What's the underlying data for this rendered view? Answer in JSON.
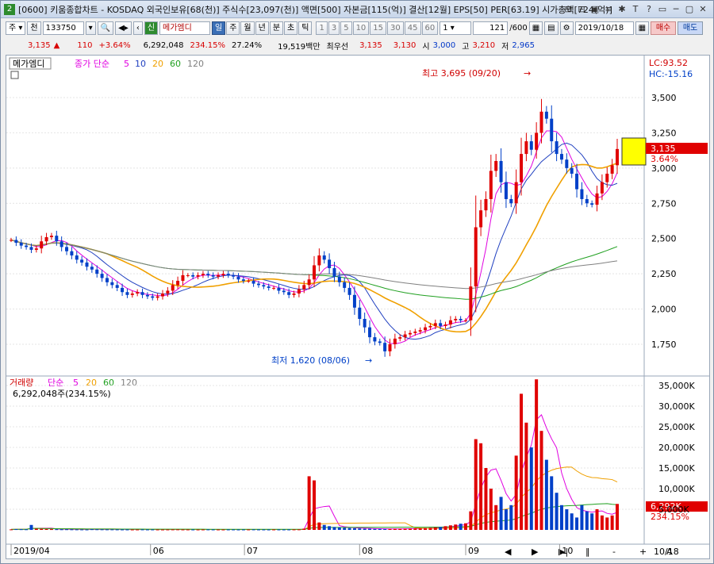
{
  "window": {
    "number": "2",
    "title": "[0600] 키움종합차트 - KOSDAQ 외국인보유[68(천)] 주식수[23,097(천)] 액면[500] 자본금[115(억)] 결산[12월] EPS[50] PER[63.19] 시가총액[724(억)]",
    "icons": [
      "⊞",
      "⊟",
      "▣",
      "≡",
      "✱",
      "T",
      "?",
      "▭",
      "─",
      "▢",
      "✕"
    ]
  },
  "toolbar": {
    "market": "주",
    "chart_type": "천",
    "code": "133750",
    "credit": "신",
    "stock_name": "메가엠디",
    "periods": [
      "일",
      "주",
      "월",
      "년",
      "분",
      "초",
      "틱"
    ],
    "active_period": "일",
    "intervals": [
      "1",
      "3",
      "5",
      "10",
      "15",
      "30",
      "45",
      "60"
    ],
    "count_select": "1",
    "view": "121",
    "total": "/600",
    "date": "2019/10/18",
    "buy": "매수",
    "sell": "매도"
  },
  "quote": {
    "price": "3,135",
    "arrow": "▲",
    "change": "110",
    "change_pct": "+3.64%",
    "volume": "6,292,048",
    "volume_ratio": "234.15%",
    "turnover": "27.24%",
    "amount": "19,519백만",
    "best": "최우선",
    "ask": "3,135",
    "bid": "3,130",
    "open_label": "시",
    "open": "3,000",
    "high_label": "고",
    "high": "3,210",
    "low_label": "저",
    "low": "2,965"
  },
  "price_panel": {
    "stock_label": "메가엠디",
    "ma_title": "종가 단순",
    "ma_periods": [
      "5",
      "10",
      "20",
      "60",
      "120"
    ],
    "lc": "LC:93.52",
    "hc": "HC:-15.16",
    "current_price": "3,135",
    "current_pct": "3.64%",
    "high_annotation": "최고 3,695 (09/20)",
    "low_annotation": "최저 1,620 (08/06)",
    "y_ticks": [
      "3,500",
      "3,250",
      "3,000",
      "2,750",
      "2,500",
      "2,250",
      "2,000",
      "1,750"
    ]
  },
  "volume_panel": {
    "title": "거래량",
    "ma_title": "단순",
    "ma_periods": [
      "5",
      "20",
      "60",
      "120"
    ],
    "current_volume": "6,292,048주(234.15%)",
    "current_tag": "6,292K",
    "ratio_tag": "234.15%",
    "y_ticks": [
      "35,000K",
      "30,000K",
      "25,000K",
      "20,000K",
      "15,000K",
      "10,000K",
      "5,000K"
    ]
  },
  "x_axis": {
    "labels": [
      "2019/04",
      "06",
      "07",
      "08",
      "09",
      "10"
    ],
    "end_label": "10/18"
  },
  "colors": {
    "up": "#e00000",
    "down": "#0040c8",
    "ma5": "#e000e0",
    "ma10": "#2040c0",
    "ma20": "#f0a000",
    "ma60": "#20a020",
    "ma120": "#808080"
  },
  "chart_data": {
    "type": "candlestick",
    "price_ylim": [
      1620,
      3695
    ],
    "y_ticks_price": [
      1750,
      2000,
      2250,
      2500,
      2750,
      3000,
      3250,
      3500
    ],
    "volume_ylim": [
      0,
      37000
    ],
    "y_ticks_volume_k": [
      5000,
      10000,
      15000,
      20000,
      25000,
      30000,
      35000
    ],
    "closes": [
      2490,
      2470,
      2450,
      2440,
      2420,
      2430,
      2480,
      2510,
      2520,
      2480,
      2440,
      2410,
      2380,
      2350,
      2330,
      2300,
      2280,
      2250,
      2220,
      2190,
      2170,
      2150,
      2120,
      2100,
      2110,
      2120,
      2100,
      2090,
      2080,
      2090,
      2110,
      2130,
      2170,
      2200,
      2240,
      2240,
      2230,
      2240,
      2250,
      2240,
      2230,
      2240,
      2250,
      2240,
      2230,
      2210,
      2200,
      2200,
      2180,
      2170,
      2160,
      2150,
      2150,
      2130,
      2120,
      2100,
      2110,
      2140,
      2170,
      2210,
      2310,
      2380,
      2350,
      2290,
      2230,
      2190,
      2150,
      2100,
      2010,
      1930,
      1870,
      1800,
      1770,
      1760,
      1700,
      1750,
      1790,
      1800,
      1820,
      1830,
      1840,
      1850,
      1870,
      1880,
      1900,
      1880,
      1890,
      1920,
      1930,
      1920,
      1920,
      2160,
      2580,
      2700,
      2780,
      2980,
      3050,
      2900,
      2780,
      2750,
      2900,
      3100,
      3190,
      3130,
      3250,
      3400,
      3350,
      3190,
      3100,
      3060,
      3000,
      2960,
      2850,
      2780,
      2750,
      2740,
      2820,
      2900,
      2960,
      3020,
      3135
    ],
    "volumes_k": [
      120,
      180,
      160,
      140,
      1200,
      300,
      250,
      200,
      180,
      160,
      140,
      150,
      130,
      120,
      110,
      100,
      160,
      140,
      130,
      120,
      120,
      110,
      100,
      100,
      90,
      95,
      110,
      100,
      100,
      95,
      90,
      100,
      110,
      120,
      100,
      100,
      95,
      90,
      100,
      110,
      100,
      95,
      90,
      100,
      100,
      90,
      95,
      100,
      110,
      100,
      95,
      90,
      100,
      100,
      95,
      100,
      110,
      120,
      300,
      13000,
      12000,
      1800,
      1200,
      900,
      700,
      600,
      500,
      450,
      400,
      350,
      300,
      280,
      250,
      230,
      220,
      240,
      260,
      280,
      300,
      320,
      350,
      400,
      450,
      500,
      600,
      700,
      900,
      1100,
      1300,
      1500,
      1600,
      4500,
      22000,
      21000,
      15000,
      10000,
      6000,
      8000,
      5000,
      6000,
      18000,
      33000,
      26000,
      20000,
      36500,
      24000,
      17000,
      13000,
      9000,
      6000,
      5000,
      4000,
      3000,
      6000,
      4500,
      4000,
      5000,
      3500,
      3000,
      3500,
      6292
    ]
  }
}
